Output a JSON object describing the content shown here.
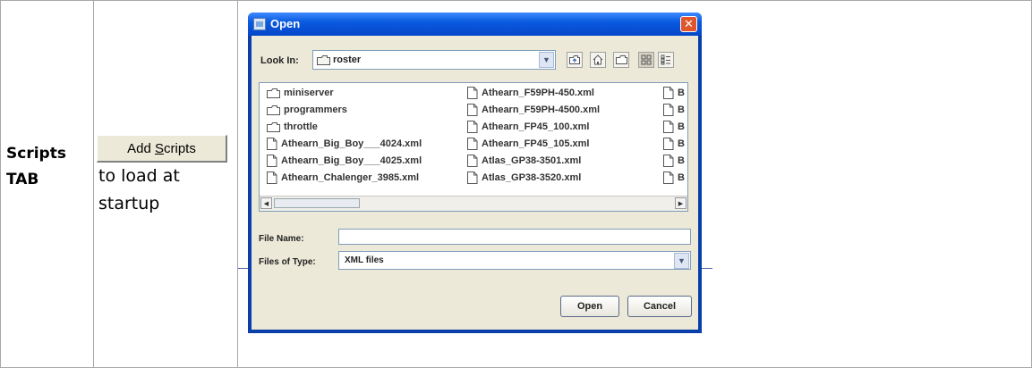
{
  "doc": {
    "row_label": "Scripts TAB",
    "row_label_line1": "Scripts",
    "row_label_line2": "TAB",
    "button_prefix": "Add ",
    "button_mnemonic": "S",
    "button_suffix": "cripts",
    "description_lines": [
      "to load at",
      "startup"
    ]
  },
  "dialog": {
    "title": "Open",
    "close_label": "✕",
    "look_in_label": "Look In:",
    "look_in_value": "roster",
    "toolbar_icons": [
      "up-folder-icon",
      "home-icon",
      "new-folder-icon",
      "list-view-icon",
      "details-view-icon"
    ],
    "files": {
      "column1": [
        {
          "name": "miniserver",
          "type": "folder"
        },
        {
          "name": "programmers",
          "type": "folder"
        },
        {
          "name": "throttle",
          "type": "folder"
        },
        {
          "name": "Athearn_Big_Boy___4024.xml",
          "type": "file"
        },
        {
          "name": "Athearn_Big_Boy___4025.xml",
          "type": "file"
        },
        {
          "name": "Athearn_Chalenger_3985.xml",
          "type": "file"
        }
      ],
      "column2": [
        {
          "name": "Athearn_F59PH-450.xml",
          "type": "file"
        },
        {
          "name": "Athearn_F59PH-4500.xml",
          "type": "file"
        },
        {
          "name": "Athearn_FP45_100.xml",
          "type": "file"
        },
        {
          "name": "Athearn_FP45_105.xml",
          "type": "file"
        },
        {
          "name": "Atlas_GP38-3501.xml",
          "type": "file"
        },
        {
          "name": "Atlas_GP38-3520.xml",
          "type": "file"
        }
      ],
      "column3": [
        {
          "name": "B",
          "type": "file"
        },
        {
          "name": "B",
          "type": "file"
        },
        {
          "name": "B",
          "type": "file"
        },
        {
          "name": "B",
          "type": "file"
        },
        {
          "name": "B",
          "type": "file"
        },
        {
          "name": "B",
          "type": "file"
        }
      ]
    },
    "file_name_label": "File Name:",
    "file_name_value": "",
    "files_of_type_label": "Files of Type:",
    "files_of_type_value": "XML files",
    "open_button": "Open",
    "cancel_button": "Cancel"
  },
  "colors": {
    "title_bar": "#0a5ae0",
    "close_button": "#e0552c",
    "dialog_body": "#ece9d8",
    "table_border": "#a8a8a8"
  }
}
